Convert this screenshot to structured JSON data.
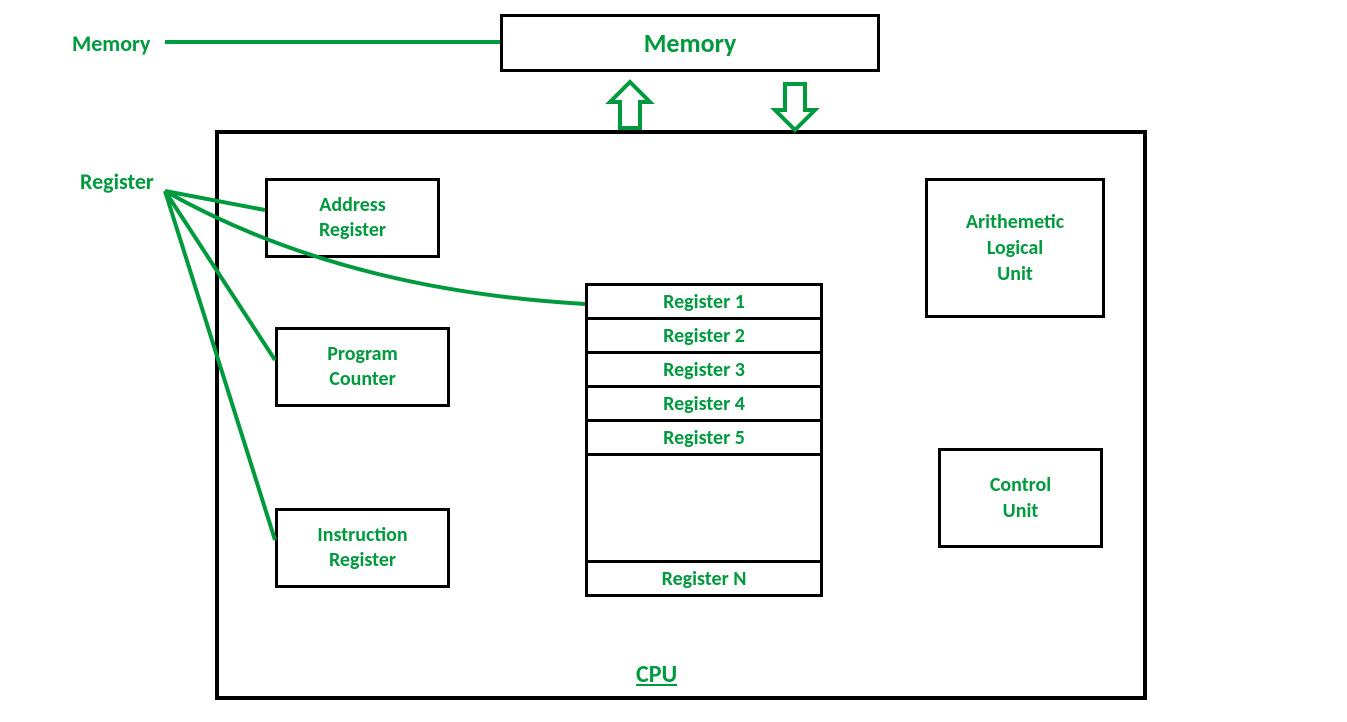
{
  "labels": {
    "memory_side": "Memory",
    "register_side": "Register",
    "cpu": "CPU"
  },
  "boxes": {
    "memory": "Memory",
    "address_register_line1": "Address",
    "address_register_line2": "Register",
    "program_counter_line1": "Program",
    "program_counter_line2": "Counter",
    "instruction_register_line1": "Instruction",
    "instruction_register_line2": "Register",
    "alu_line1": "Arithemetic",
    "alu_line2": "Logical",
    "alu_line3": "Unit",
    "control_unit_line1": "Control",
    "control_unit_line2": "Unit"
  },
  "register_stack": {
    "r1": "Register 1",
    "r2": "Register 2",
    "r3": "Register 3",
    "r4": "Register 4",
    "r5": "Register 5",
    "blank": "",
    "rn": "Register N"
  },
  "colors": {
    "accent": "#009A3E"
  }
}
